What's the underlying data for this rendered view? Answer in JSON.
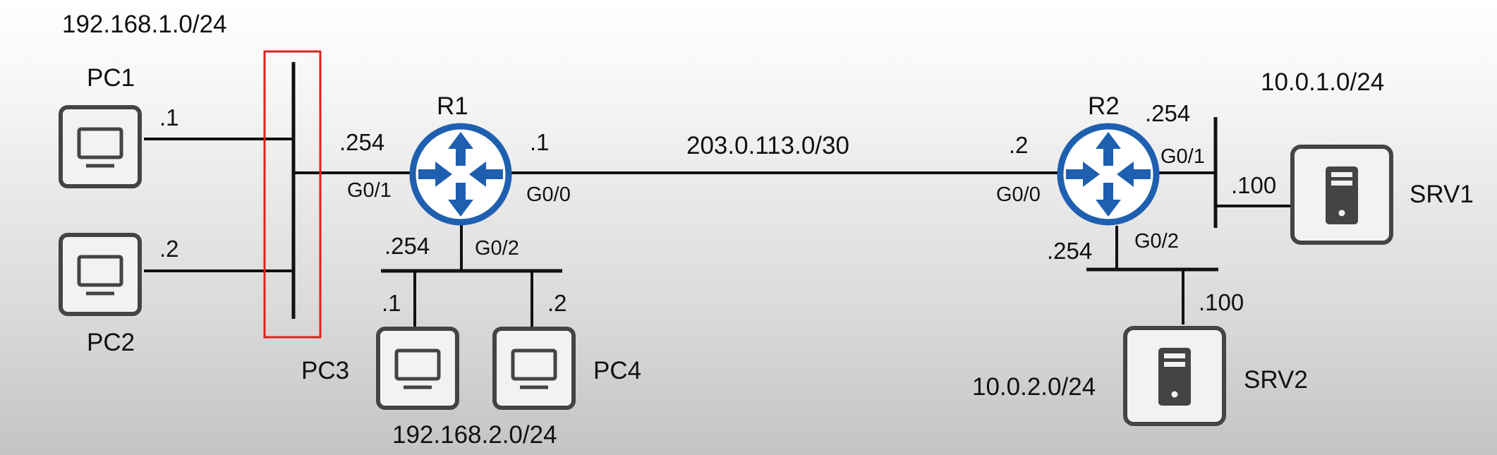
{
  "networks": {
    "lan1": "192.168.1.0/24",
    "lan2": "192.168.2.0/24",
    "wan": "203.0.113.0/30",
    "srv1_net": "10.0.1.0/24",
    "srv2_net": "10.0.2.0/24"
  },
  "devices": {
    "pc1": "PC1",
    "pc2": "PC2",
    "pc3": "PC3",
    "pc4": "PC4",
    "r1": "R1",
    "r2": "R2",
    "srv1": "SRV1",
    "srv2": "SRV2"
  },
  "addresses": {
    "pc1": ".1",
    "pc2": ".2",
    "pc3": ".1",
    "pc4": ".2",
    "r1_g01": ".254",
    "r1_g00": ".1",
    "r1_g02": ".254",
    "r2_g00": ".2",
    "r2_g01": ".254",
    "r2_g02": ".254",
    "srv1": ".100",
    "srv2": ".100"
  },
  "interfaces": {
    "r1_g01": "G0/1",
    "r1_g00": "G0/0",
    "r1_g02": "G0/2",
    "r2_g00": "G0/0",
    "r2_g01": "G0/1",
    "r2_g02": "G0/2"
  },
  "colors": {
    "router": "#1f5fb0",
    "highlight": "#e02020",
    "line": "#111111"
  },
  "icons": {
    "pc": "pc-icon",
    "router": "router-icon",
    "server": "server-icon"
  }
}
